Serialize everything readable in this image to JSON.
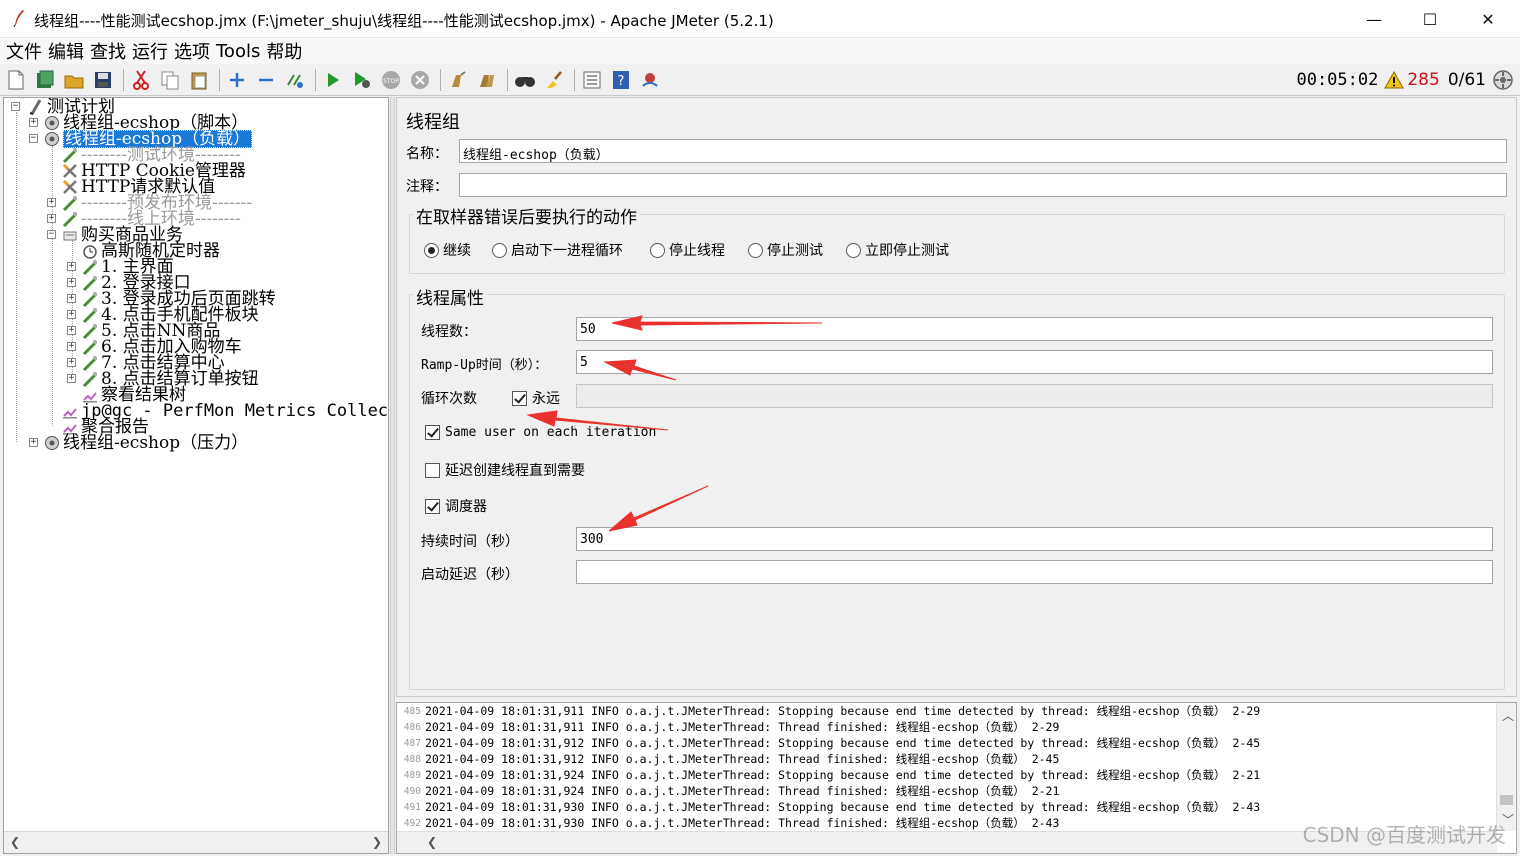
{
  "window": {
    "title": "线程组----性能测试ecshop.jmx (F:\\jmeter_shuju\\线程组----性能测试ecshop.jmx) - Apache JMeter (5.2.1)",
    "minimize": "—",
    "maximize": "☐",
    "close": "✕"
  },
  "menu": [
    "文件",
    "编辑",
    "查找",
    "运行",
    "选项",
    "Tools",
    "帮助"
  ],
  "toolbar": {
    "elapsed": "00:05:02",
    "warnings": "285",
    "threads": "0/61"
  },
  "tree": [
    {
      "label": "测试计划",
      "icon": "test-plan-icon"
    },
    {
      "label": "线程组-ecshop（脚本）",
      "icon": "thread-group-icon"
    },
    {
      "label": "线程组-ecshop（负载）",
      "icon": "thread-group-icon",
      "selected": true
    },
    {
      "label": "--------测试环境--------",
      "icon": "config-icon",
      "disabled": true
    },
    {
      "label": "HTTP Cookie管理器",
      "icon": "tools-icon"
    },
    {
      "label": "HTTP请求默认值",
      "icon": "tools-icon"
    },
    {
      "label": "--------预发布环境-------",
      "icon": "config-icon",
      "disabled": true
    },
    {
      "label": "--------线上环境--------",
      "icon": "config-icon",
      "disabled": true
    },
    {
      "label": "购买商品业务",
      "icon": "transaction-icon"
    },
    {
      "label": "高斯随机定时器",
      "icon": "timer-icon"
    },
    {
      "label": "1. 主界面",
      "icon": "controller-icon"
    },
    {
      "label": "2. 登录接口",
      "icon": "controller-icon"
    },
    {
      "label": "3. 登录成功后页面跳转",
      "icon": "controller-icon"
    },
    {
      "label": "4. 点击手机配件板块",
      "icon": "controller-icon"
    },
    {
      "label": "5. 点击NN商品",
      "icon": "controller-icon"
    },
    {
      "label": "6. 点击加入购物车",
      "icon": "controller-icon"
    },
    {
      "label": "7. 点击结算中心",
      "icon": "controller-icon"
    },
    {
      "label": "8. 点击结算订单按钮",
      "icon": "controller-icon"
    },
    {
      "label": "察看结果树",
      "icon": "listener-icon"
    },
    {
      "label": "jp@gc - PerfMon Metrics Collector",
      "icon": "listener-icon"
    },
    {
      "label": "聚合报告",
      "icon": "listener-icon"
    },
    {
      "label": "线程组-ecshop（压力）",
      "icon": "thread-group-icon"
    }
  ],
  "panel": {
    "title": "线程组",
    "name_label": "名称：",
    "name_value": "线程组-ecshop（负载）",
    "comment_label": "注释：",
    "comment_value": "",
    "error_group_title": "在取样器错误后要执行的动作",
    "error_actions": [
      {
        "label": "继续",
        "selected": true
      },
      {
        "label": "启动下一进程循环",
        "selected": false
      },
      {
        "label": "停止线程",
        "selected": false
      },
      {
        "label": "停止测试",
        "selected": false
      },
      {
        "label": "立即停止测试",
        "selected": false
      }
    ],
    "thread_group_title": "线程属性",
    "threads_label": "线程数：",
    "threads_value": "50",
    "rampup_label": "Ramp-Up时间（秒）：",
    "rampup_value": "5",
    "loop_label": "循环次数",
    "forever_label": "永远",
    "forever_checked": true,
    "loop_value": "",
    "same_user_label": "Same user on each iteration",
    "same_user_checked": true,
    "delay_label": "延迟创建线程直到需要",
    "delay_checked": false,
    "scheduler_label": "调度器",
    "scheduler_checked": true,
    "duration_label": "持续时间（秒）",
    "duration_value": "300",
    "startup_delay_label": "启动延迟（秒）",
    "startup_delay_value": ""
  },
  "log": [
    {
      "n": "485",
      "text": "2021-04-09 18:01:31,911 INFO o.a.j.t.JMeterThread: Stopping because end time detected by thread: 线程组-ecshop（负载） 2-29"
    },
    {
      "n": "486",
      "text": "2021-04-09 18:01:31,911 INFO o.a.j.t.JMeterThread: Thread finished: 线程组-ecshop（负载） 2-29"
    },
    {
      "n": "487",
      "text": "2021-04-09 18:01:31,912 INFO o.a.j.t.JMeterThread: Stopping because end time detected by thread: 线程组-ecshop（负载） 2-45"
    },
    {
      "n": "488",
      "text": "2021-04-09 18:01:31,912 INFO o.a.j.t.JMeterThread: Thread finished: 线程组-ecshop（负载） 2-45"
    },
    {
      "n": "489",
      "text": "2021-04-09 18:01:31,924 INFO o.a.j.t.JMeterThread: Stopping because end time detected by thread: 线程组-ecshop（负载） 2-21"
    },
    {
      "n": "490",
      "text": "2021-04-09 18:01:31,924 INFO o.a.j.t.JMeterThread: Thread finished: 线程组-ecshop（负载） 2-21"
    },
    {
      "n": "491",
      "text": "2021-04-09 18:01:31,930 INFO o.a.j.t.JMeterThread: Stopping because end time detected by thread: 线程组-ecshop（负载） 2-43"
    },
    {
      "n": "492",
      "text": "2021-04-09 18:01:31,930 INFO o.a.j.t.JMeterThread: Thread finished: 线程组-ecshop（负载） 2-43"
    }
  ],
  "watermark": "CSDN @百度测试开发",
  "colors": {
    "selection": "#1a78d6",
    "warning": "#d01010",
    "arrow": "#e8322d"
  }
}
